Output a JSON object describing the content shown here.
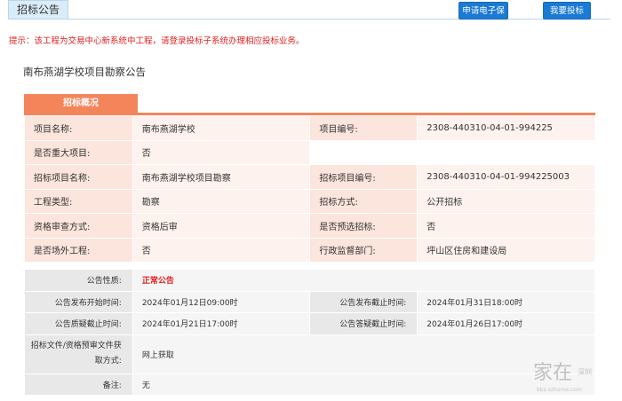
{
  "header": {
    "tab_label": "招标公告",
    "buttons": {
      "guarantee": "申请电子保函",
      "bid": "我要投标"
    }
  },
  "tip": "提示：该工程为交易中心新系统中工程，请登录投标子系统办理相应投标业务。",
  "announcement_title": "南布燕湖学校项目勘察公告",
  "section": {
    "tab_label": "招标概况"
  },
  "info": {
    "project_name_label": "项目名称:",
    "project_name": "南布燕湖学校",
    "project_code_label": "项目编号:",
    "project_code": "2308-440310-04-01-994225",
    "major_label": "是否重大项目:",
    "major": "否",
    "bid_project_name_label": "招标项目名称:",
    "bid_project_name": "南布燕湖学校项目勘察",
    "bid_project_code_label": "招标项目编号:",
    "bid_project_code": "2308-440310-04-01-994225003",
    "work_type_label": "工程类型:",
    "work_type": "勘察",
    "bid_method_label": "招标方式:",
    "bid_method": "公开招标",
    "qual_method_label": "资格审查方式:",
    "qual_method": "资格后审",
    "preselect_label": "是否预选招标:",
    "preselect": "否",
    "offsite_label": "是否场外工程:",
    "offsite": "否",
    "supervisor_label": "行政监督部门:",
    "supervisor": "坪山区住房和建设局"
  },
  "status": {
    "nature_label": "公告性质:",
    "nature": "正常公告",
    "publish_start_label": "公告发布开始时间:",
    "publish_start": "2024年01月12日09:00时",
    "publish_end_label": "公告发布截止时间:",
    "publish_end": "2024年01月31日18:00时",
    "query_deadline_label": "公告质疑截止时间:",
    "query_deadline": "2024年01月21日17:00时",
    "answer_deadline_label": "公告答疑截止时间:",
    "answer_deadline": "2024年01月26日17:00时",
    "doc_method_label": "招标文件/资格预审文件获取方式:",
    "doc_method": "网上获取",
    "remark_label": "备注:",
    "remark": "无"
  },
  "watermark": {
    "main": "家在",
    "sub": "深圳",
    "url": "bbs.szhome.com"
  },
  "colors": {
    "accent_orange": "#f4855b",
    "button_blue": "#1a7ad4",
    "tip_red": "#e02020"
  }
}
